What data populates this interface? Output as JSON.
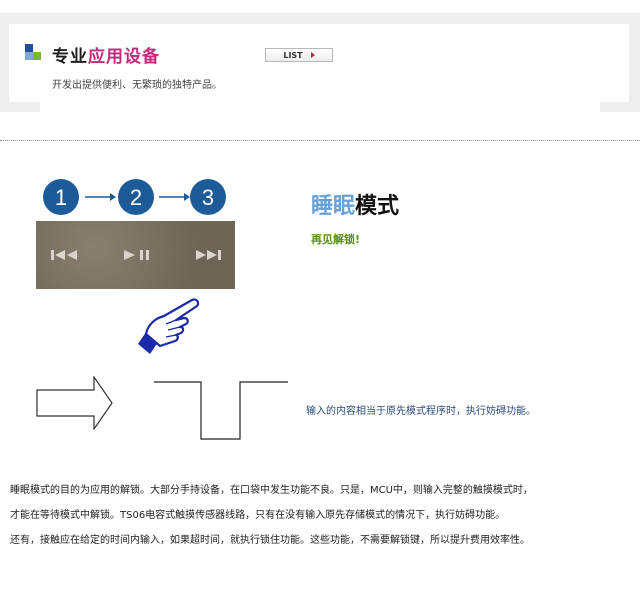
{
  "header": {
    "title_part1": "专业",
    "title_part2": "应用设备",
    "subtitle": "开发出提供便利、无繁琐的独特产品。",
    "list_button_label": "LIST",
    "colors": {
      "title_dark": "#1e1e1e",
      "title_accent": "#c12a7a",
      "logo_blue": "#1f4e96",
      "logo_green": "#7bb82d"
    }
  },
  "steps": {
    "numbers": [
      "1",
      "2",
      "3"
    ],
    "circle_color": "#1d5a98",
    "arrow_icon": "right-arrow-icon"
  },
  "controls": {
    "icons": [
      "previous-track-icon",
      "play-pause-icon",
      "next-track-icon"
    ]
  },
  "feature": {
    "title_part1": "睡眠",
    "title_part2": "模式",
    "tagline": "再见解锁!",
    "description": "输入的内容相当于原先模式程序时，执行妨碍功能。"
  },
  "body": {
    "lines": [
      "睡眠模式的目的为应用的解锁。大部分手持设备，在口袋中发生功能不良。只是，MCU中，则输入完整的触摸模式时，",
      "才能在等待模式中解锁。TS06电容式触摸传感器线路，只有在没有输入原先存储模式的情况下，执行妨碍功能。",
      "还有，接触应在给定的时间内输入，如果超时间，就执行锁住功能。这些功能，不需要解锁键，所以提升费用效率性。"
    ]
  }
}
